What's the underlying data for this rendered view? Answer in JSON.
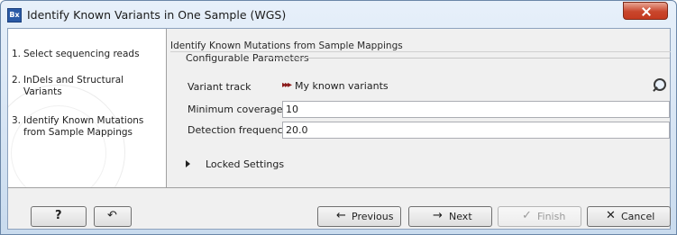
{
  "window": {
    "app_icon": "Bx",
    "title": "Identify Known Variants in One Sample (WGS)",
    "close_icon": "close-icon"
  },
  "steps": [
    {
      "num": "1.",
      "label": "Select sequencing reads"
    },
    {
      "num": "2.",
      "label": "InDels and Structural Variants"
    },
    {
      "num": "3.",
      "label": "Identify Known Mutations from Sample Mappings"
    }
  ],
  "panel": {
    "title": "Identify Known Mutations from Sample Mappings",
    "group_title": "Configurable Parameters",
    "variant_track": {
      "label": "Variant track",
      "value": "My known variants",
      "icon": "variant-track-icon",
      "browse_icon": "browse-icon"
    },
    "minimum_coverage": {
      "label": "Minimum coverage",
      "value": "10"
    },
    "detection_frequency": {
      "label": "Detection frequency",
      "value": "20.0"
    },
    "locked_settings": {
      "label": "Locked Settings",
      "icon": "expand-arrow-icon"
    }
  },
  "buttons": {
    "help": {
      "label": "?",
      "icon": "help-icon"
    },
    "reset": {
      "icon": "reset-icon"
    },
    "previous": {
      "label": "Previous",
      "icon": "arrow-left-icon"
    },
    "next": {
      "label": "Next",
      "icon": "arrow-right-icon"
    },
    "finish": {
      "label": "Finish",
      "icon": "check-icon",
      "enabled": false
    },
    "cancel": {
      "label": "Cancel",
      "icon": "x-icon"
    }
  }
}
